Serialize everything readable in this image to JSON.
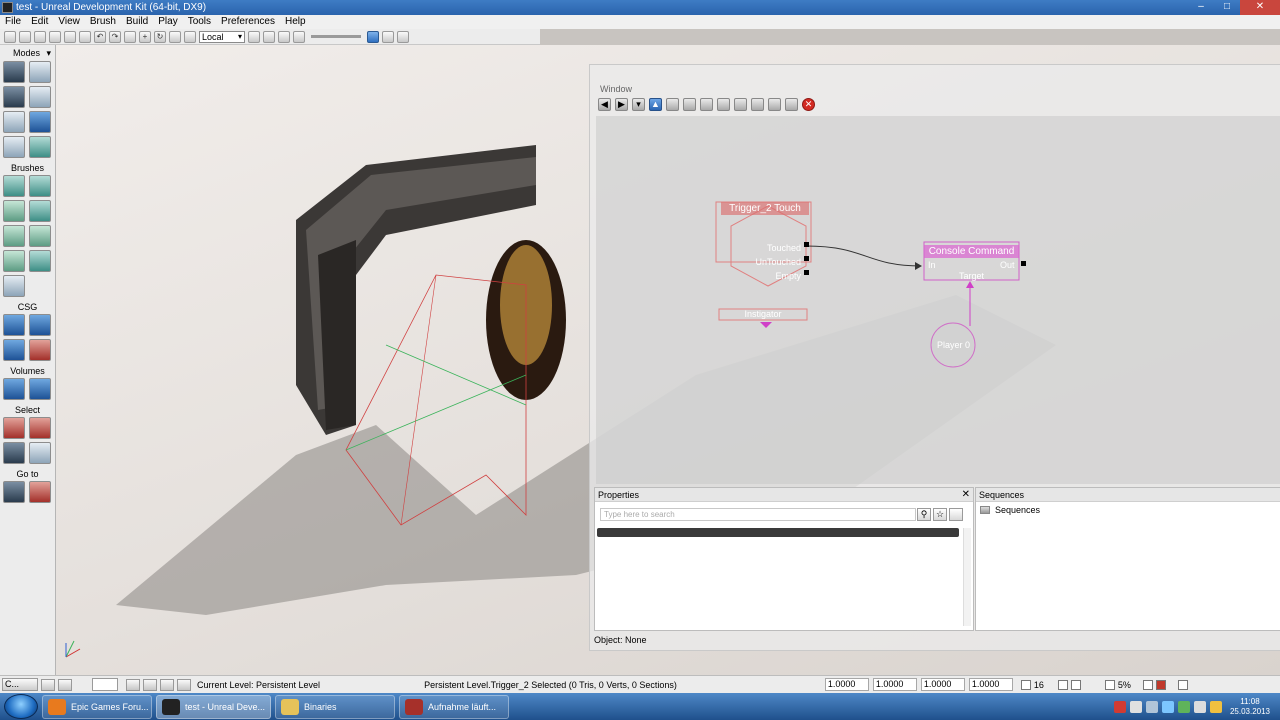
{
  "window": {
    "title": "test - Unreal Development Kit (64-bit, DX9)"
  },
  "menu": [
    "File",
    "Edit",
    "View",
    "Brush",
    "Build",
    "Play",
    "Tools",
    "Preferences",
    "Help"
  ],
  "toolbar": {
    "coord_system": "Local"
  },
  "modes": {
    "title": "Modes",
    "sections": {
      "brushes": "Brushes",
      "csg": "CSG",
      "volumes": "Volumes",
      "select": "Select",
      "goto": "Go to"
    }
  },
  "kismet": {
    "title": "Window",
    "nodes": {
      "trigger": {
        "title": "Trigger_2 Touch",
        "outputs": [
          "Touched",
          "UnTouched",
          "Empty"
        ],
        "var_link": "Instigator"
      },
      "console": {
        "title": "Console Command",
        "input": "In",
        "output": "Out",
        "var_link": "Target"
      },
      "player": {
        "label": "Player 0"
      }
    },
    "properties": {
      "title": "Properties",
      "search_placeholder": "Type here to search"
    },
    "sequences": {
      "title": "Sequences",
      "root": "Sequences"
    },
    "status": "Object: None"
  },
  "statusbar": {
    "cmd": "C...",
    "current_level": "Current Level:  Persistent Level",
    "selection": "Persistent Level.Trigger_2 Selected (0 Tris, 0 Verts, 0 Sections)",
    "values": [
      "1.0000",
      "1.0000",
      "1.0000",
      "1.0000"
    ],
    "grid": "16",
    "percent": "5%"
  },
  "taskbar": {
    "items": [
      {
        "label": "Epic Games Foru...",
        "color": "#e87a1e"
      },
      {
        "label": "test - Unreal Deve...",
        "color": "#222222"
      },
      {
        "label": "Binaries",
        "color": "#e6c25a"
      },
      {
        "label": "Aufnahme läuft...",
        "color": "#a6302a"
      }
    ],
    "time": "11:08",
    "date": "25.03.2013"
  }
}
